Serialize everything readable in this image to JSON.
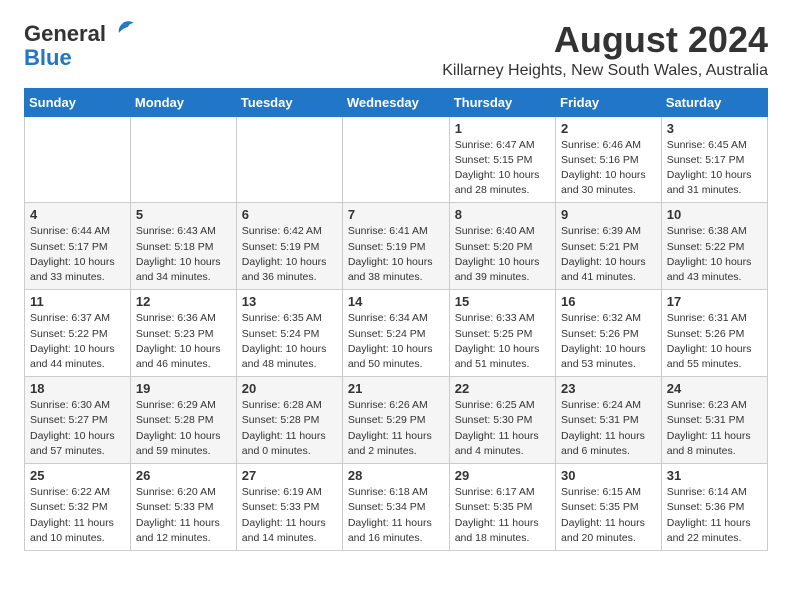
{
  "logo": {
    "general": "General",
    "blue": "Blue"
  },
  "title": {
    "month_year": "August 2024",
    "location": "Killarney Heights, New South Wales, Australia"
  },
  "headers": [
    "Sunday",
    "Monday",
    "Tuesday",
    "Wednesday",
    "Thursday",
    "Friday",
    "Saturday"
  ],
  "weeks": [
    [
      {
        "day": "",
        "info": ""
      },
      {
        "day": "",
        "info": ""
      },
      {
        "day": "",
        "info": ""
      },
      {
        "day": "",
        "info": ""
      },
      {
        "day": "1",
        "info": "Sunrise: 6:47 AM\nSunset: 5:15 PM\nDaylight: 10 hours\nand 28 minutes."
      },
      {
        "day": "2",
        "info": "Sunrise: 6:46 AM\nSunset: 5:16 PM\nDaylight: 10 hours\nand 30 minutes."
      },
      {
        "day": "3",
        "info": "Sunrise: 6:45 AM\nSunset: 5:17 PM\nDaylight: 10 hours\nand 31 minutes."
      }
    ],
    [
      {
        "day": "4",
        "info": "Sunrise: 6:44 AM\nSunset: 5:17 PM\nDaylight: 10 hours\nand 33 minutes."
      },
      {
        "day": "5",
        "info": "Sunrise: 6:43 AM\nSunset: 5:18 PM\nDaylight: 10 hours\nand 34 minutes."
      },
      {
        "day": "6",
        "info": "Sunrise: 6:42 AM\nSunset: 5:19 PM\nDaylight: 10 hours\nand 36 minutes."
      },
      {
        "day": "7",
        "info": "Sunrise: 6:41 AM\nSunset: 5:19 PM\nDaylight: 10 hours\nand 38 minutes."
      },
      {
        "day": "8",
        "info": "Sunrise: 6:40 AM\nSunset: 5:20 PM\nDaylight: 10 hours\nand 39 minutes."
      },
      {
        "day": "9",
        "info": "Sunrise: 6:39 AM\nSunset: 5:21 PM\nDaylight: 10 hours\nand 41 minutes."
      },
      {
        "day": "10",
        "info": "Sunrise: 6:38 AM\nSunset: 5:22 PM\nDaylight: 10 hours\nand 43 minutes."
      }
    ],
    [
      {
        "day": "11",
        "info": "Sunrise: 6:37 AM\nSunset: 5:22 PM\nDaylight: 10 hours\nand 44 minutes."
      },
      {
        "day": "12",
        "info": "Sunrise: 6:36 AM\nSunset: 5:23 PM\nDaylight: 10 hours\nand 46 minutes."
      },
      {
        "day": "13",
        "info": "Sunrise: 6:35 AM\nSunset: 5:24 PM\nDaylight: 10 hours\nand 48 minutes."
      },
      {
        "day": "14",
        "info": "Sunrise: 6:34 AM\nSunset: 5:24 PM\nDaylight: 10 hours\nand 50 minutes."
      },
      {
        "day": "15",
        "info": "Sunrise: 6:33 AM\nSunset: 5:25 PM\nDaylight: 10 hours\nand 51 minutes."
      },
      {
        "day": "16",
        "info": "Sunrise: 6:32 AM\nSunset: 5:26 PM\nDaylight: 10 hours\nand 53 minutes."
      },
      {
        "day": "17",
        "info": "Sunrise: 6:31 AM\nSunset: 5:26 PM\nDaylight: 10 hours\nand 55 minutes."
      }
    ],
    [
      {
        "day": "18",
        "info": "Sunrise: 6:30 AM\nSunset: 5:27 PM\nDaylight: 10 hours\nand 57 minutes."
      },
      {
        "day": "19",
        "info": "Sunrise: 6:29 AM\nSunset: 5:28 PM\nDaylight: 10 hours\nand 59 minutes."
      },
      {
        "day": "20",
        "info": "Sunrise: 6:28 AM\nSunset: 5:28 PM\nDaylight: 11 hours\nand 0 minutes."
      },
      {
        "day": "21",
        "info": "Sunrise: 6:26 AM\nSunset: 5:29 PM\nDaylight: 11 hours\nand 2 minutes."
      },
      {
        "day": "22",
        "info": "Sunrise: 6:25 AM\nSunset: 5:30 PM\nDaylight: 11 hours\nand 4 minutes."
      },
      {
        "day": "23",
        "info": "Sunrise: 6:24 AM\nSunset: 5:31 PM\nDaylight: 11 hours\nand 6 minutes."
      },
      {
        "day": "24",
        "info": "Sunrise: 6:23 AM\nSunset: 5:31 PM\nDaylight: 11 hours\nand 8 minutes."
      }
    ],
    [
      {
        "day": "25",
        "info": "Sunrise: 6:22 AM\nSunset: 5:32 PM\nDaylight: 11 hours\nand 10 minutes."
      },
      {
        "day": "26",
        "info": "Sunrise: 6:20 AM\nSunset: 5:33 PM\nDaylight: 11 hours\nand 12 minutes."
      },
      {
        "day": "27",
        "info": "Sunrise: 6:19 AM\nSunset: 5:33 PM\nDaylight: 11 hours\nand 14 minutes."
      },
      {
        "day": "28",
        "info": "Sunrise: 6:18 AM\nSunset: 5:34 PM\nDaylight: 11 hours\nand 16 minutes."
      },
      {
        "day": "29",
        "info": "Sunrise: 6:17 AM\nSunset: 5:35 PM\nDaylight: 11 hours\nand 18 minutes."
      },
      {
        "day": "30",
        "info": "Sunrise: 6:15 AM\nSunset: 5:35 PM\nDaylight: 11 hours\nand 20 minutes."
      },
      {
        "day": "31",
        "info": "Sunrise: 6:14 AM\nSunset: 5:36 PM\nDaylight: 11 hours\nand 22 minutes."
      }
    ]
  ]
}
